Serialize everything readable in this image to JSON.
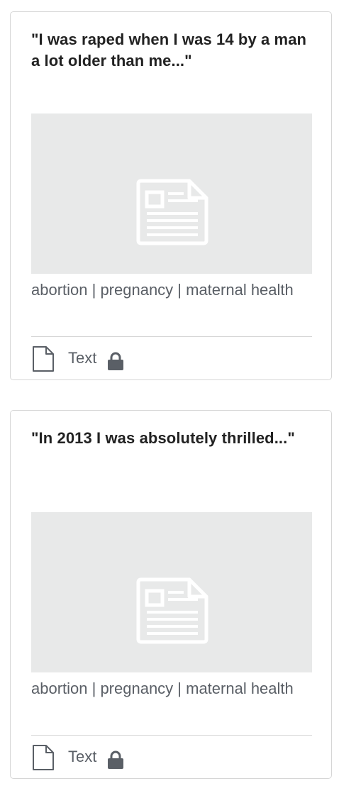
{
  "cards": [
    {
      "title": "\"I was raped when I was 14 by a man a lot older than me...\"",
      "tags": "abortion | pregnancy | maternal health",
      "type_label": "Text",
      "thumbnail_icon": "document-placeholder-icon",
      "type_icon": "document-icon",
      "access_icon": "lock-icon"
    },
    {
      "title": "\"In 2013 I was absolutely thrilled...\"",
      "tags": "abortion | pregnancy | maternal health",
      "type_label": "Text",
      "thumbnail_icon": "document-placeholder-icon",
      "type_icon": "document-icon",
      "access_icon": "lock-icon"
    }
  ],
  "colors": {
    "card_border": "#d6d6d6",
    "thumbnail_bg": "#e8e9e9",
    "title_text": "#222222",
    "meta_text": "#5a5f66",
    "icon_gray": "#5a5f66"
  }
}
